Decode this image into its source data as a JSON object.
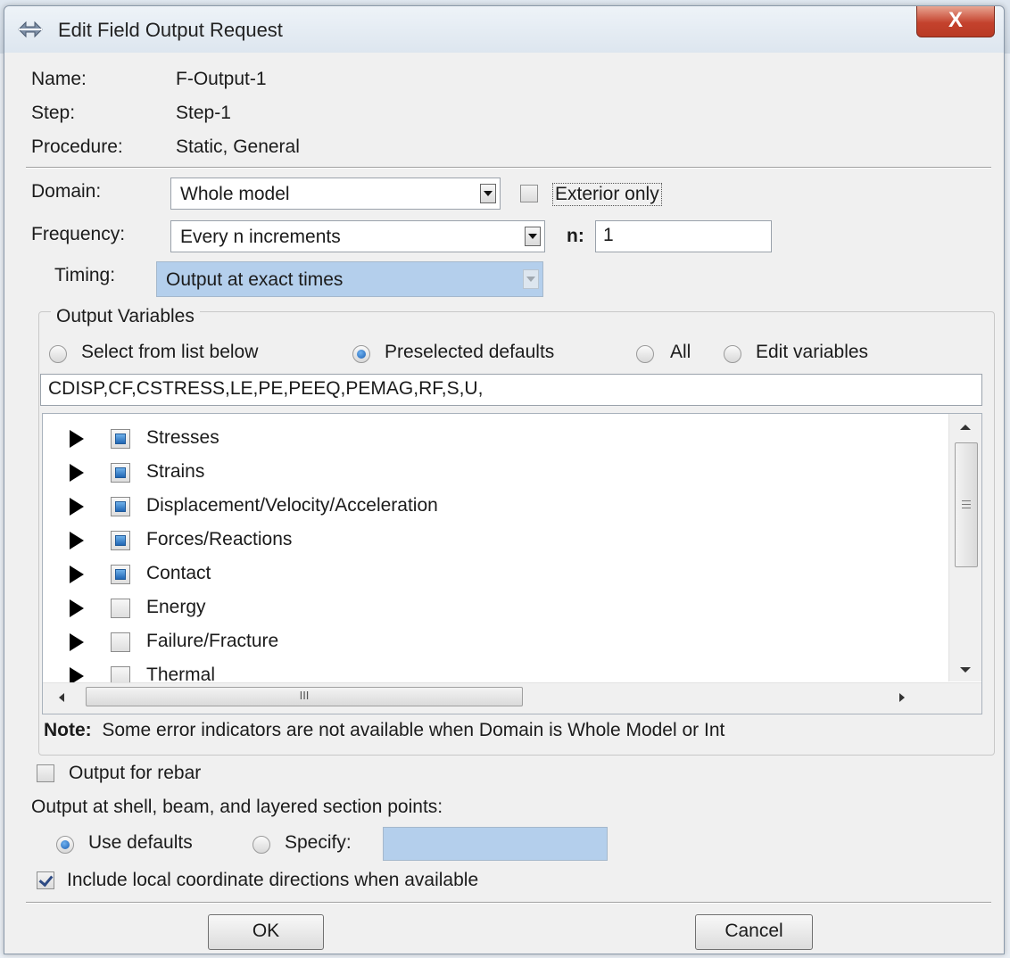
{
  "window": {
    "title": "Edit Field Output Request",
    "close_label": "X"
  },
  "info": {
    "name_label": "Name:",
    "name_value": "F-Output-1",
    "step_label": "Step:",
    "step_value": "Step-1",
    "procedure_label": "Procedure:",
    "procedure_value": "Static, General"
  },
  "domain": {
    "label": "Domain:",
    "value": "Whole model",
    "exterior_only_label": "Exterior only",
    "exterior_only_checked": false
  },
  "frequency": {
    "label": "Frequency:",
    "value": "Every n increments",
    "n_label": "n:",
    "n_value": "1"
  },
  "timing": {
    "label": "Timing:",
    "value": "Output at exact times"
  },
  "output_variables": {
    "title": "Output Variables",
    "options": [
      "Select from list below",
      "Preselected defaults",
      "All",
      "Edit variables"
    ],
    "selected_option": "Preselected defaults",
    "variables_text": "CDISP,CF,CSTRESS,LE,PE,PEEQ,PEMAG,RF,S,U,",
    "tree": [
      {
        "label": "Stresses",
        "state": "partial"
      },
      {
        "label": "Strains",
        "state": "partial"
      },
      {
        "label": "Displacement/Velocity/Acceleration",
        "state": "partial"
      },
      {
        "label": "Forces/Reactions",
        "state": "partial"
      },
      {
        "label": "Contact",
        "state": "partial"
      },
      {
        "label": "Energy",
        "state": "unchecked"
      },
      {
        "label": "Failure/Fracture",
        "state": "unchecked"
      },
      {
        "label": "Thermal",
        "state": "unchecked"
      }
    ],
    "hscroll_grip": "III",
    "note_label": "Note:",
    "note_text": "Some error indicators are not available when Domain is Whole Model or Int"
  },
  "rebar": {
    "label": "Output for rebar",
    "checked": false
  },
  "section_points": {
    "label": "Output at shell, beam, and layered section points:",
    "use_defaults_label": "Use defaults",
    "specify_label": "Specify:",
    "specify_value": "",
    "selected": "Use defaults"
  },
  "local_coords": {
    "label": "Include local coordinate directions when available",
    "checked": true
  },
  "buttons": {
    "ok": "OK",
    "cancel": "Cancel"
  }
}
